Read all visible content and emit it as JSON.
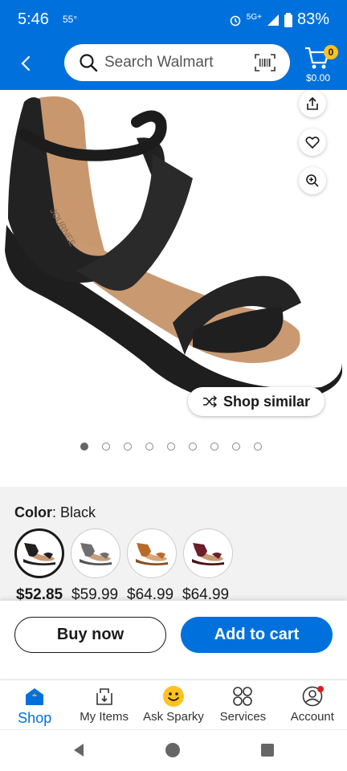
{
  "status": {
    "time": "5:46",
    "temperature": "55°",
    "network": "5G+",
    "battery": "83%"
  },
  "header": {
    "search_placeholder": "Search Walmart",
    "cart_count": "0",
    "cart_total": "$0.00"
  },
  "product_image": {
    "shop_similar_label": "Shop similar",
    "page_count": 9,
    "active_page": 1
  },
  "variants": {
    "color_label": "Color",
    "color_value": ": Black",
    "swatches": [
      {
        "name": "Black",
        "price": "$52.85",
        "selected": true,
        "color": "#1f1f1f"
      },
      {
        "name": "Grey",
        "price": "$59.99",
        "selected": false,
        "color": "#6e6e6e"
      },
      {
        "name": "Tan",
        "price": "$64.99",
        "selected": false,
        "color": "#b86a2a"
      },
      {
        "name": "Burgundy",
        "price": "$64.99",
        "selected": false,
        "color": "#6a1f2a"
      }
    ]
  },
  "actions": {
    "buy_now": "Buy now",
    "add_to_cart": "Add to cart"
  },
  "nav": {
    "shop": "Shop",
    "my_items": "My Items",
    "ask_sparky": "Ask Sparky",
    "services": "Services",
    "account": "Account"
  },
  "colors": {
    "brand_blue": "#0071dc",
    "spark_yellow": "#ffc220"
  }
}
